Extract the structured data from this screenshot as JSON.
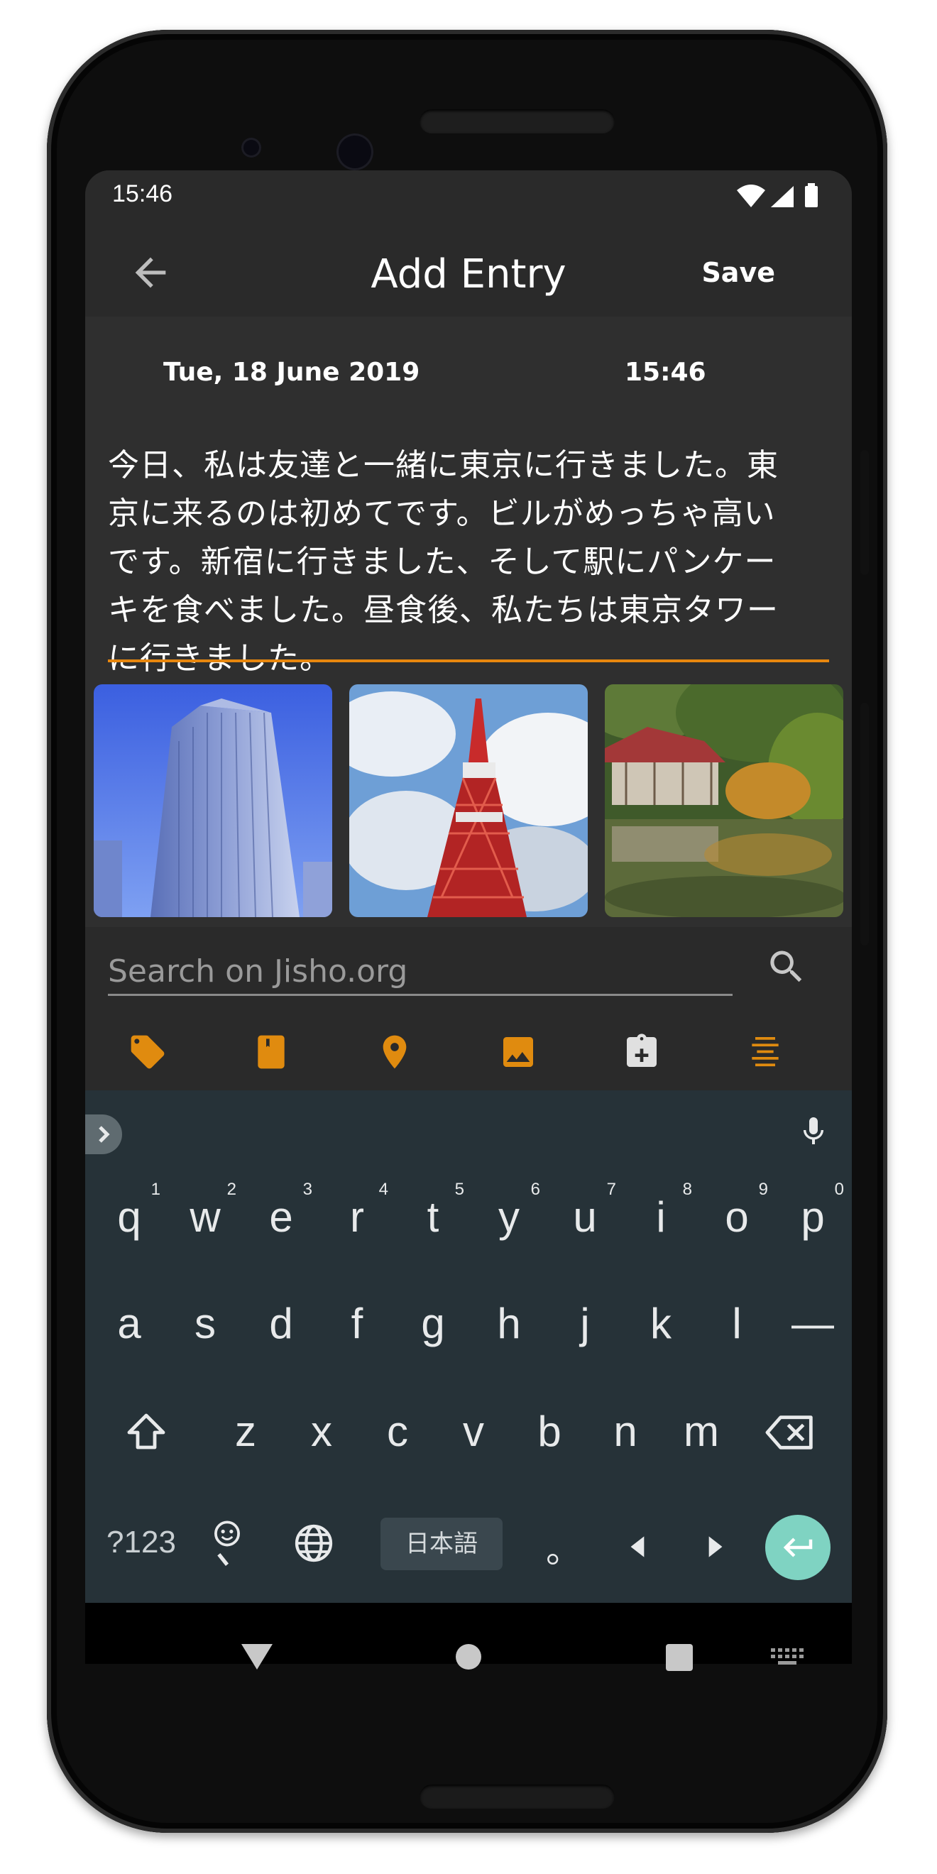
{
  "status_bar": {
    "time": "15:46"
  },
  "app_bar": {
    "title": "Add Entry",
    "save_label": "Save"
  },
  "entry": {
    "date": "Tue, 18 June 2019",
    "time": "15:46",
    "text_lines": [
      "今日、私は友達と一緒に東京に行きました。東",
      "京に来るのは初めてです。ビルがめっちゃ高い",
      "です。新宿に行きました、そして駅にパンケー",
      "キを食べました。昼食後、私たちは東京タワー",
      "に行きました。"
    ],
    "accent_color": "#e8870e"
  },
  "photos": [
    {
      "name": "skyscraper-photo"
    },
    {
      "name": "tokyo-tower-photo"
    },
    {
      "name": "japanese-garden-photo"
    }
  ],
  "search": {
    "placeholder": "Search on Jisho.org"
  },
  "toolbar_icons": [
    "tag-icon",
    "bookmark-book-icon",
    "location-pin-icon",
    "image-icon",
    "clipboard-add-icon",
    "text-align-icon"
  ],
  "keyboard": {
    "row1": [
      {
        "ch": "q",
        "hint": "1"
      },
      {
        "ch": "w",
        "hint": "2"
      },
      {
        "ch": "e",
        "hint": "3"
      },
      {
        "ch": "r",
        "hint": "4"
      },
      {
        "ch": "t",
        "hint": "5"
      },
      {
        "ch": "y",
        "hint": "6"
      },
      {
        "ch": "u",
        "hint": "7"
      },
      {
        "ch": "i",
        "hint": "8"
      },
      {
        "ch": "o",
        "hint": "9"
      },
      {
        "ch": "p",
        "hint": "0"
      }
    ],
    "row2": [
      "a",
      "s",
      "d",
      "f",
      "g",
      "h",
      "j",
      "k",
      "l",
      "—"
    ],
    "row3": [
      "z",
      "x",
      "c",
      "v",
      "b",
      "n",
      "m"
    ],
    "symbols_label": "?123",
    "language_label": "日本語",
    "period_label": "。"
  }
}
